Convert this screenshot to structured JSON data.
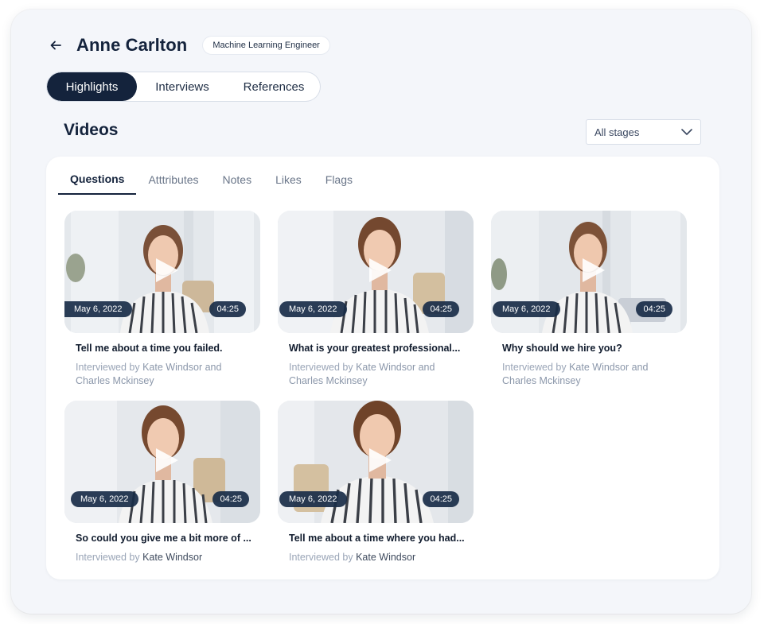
{
  "candidate": {
    "name": "Anne Carlton",
    "role": "Machine Learning Engineer"
  },
  "main_tabs": [
    {
      "label": "Highlights",
      "active": true
    },
    {
      "label": "Interviews",
      "active": false
    },
    {
      "label": "References",
      "active": false
    }
  ],
  "section": {
    "title": "Videos",
    "stage_filter": "All stages"
  },
  "sub_tabs": [
    {
      "label": "Questions",
      "active": true
    },
    {
      "label": "Atttributes",
      "active": false
    },
    {
      "label": "Notes",
      "active": false
    },
    {
      "label": "Likes",
      "active": false
    },
    {
      "label": "Flags",
      "active": false
    }
  ],
  "videos": [
    {
      "date": "May 6, 2022",
      "duration": "04:25",
      "question": "Tell me about a time you failed.",
      "interviewed_by": "Interviewed by",
      "interviewers_line1": "Kate Windsor and",
      "interviewers_line2": "Charles Mckinsey"
    },
    {
      "date": "May 6, 2022",
      "duration": "04:25",
      "question": "What is your greatest professional...",
      "interviewed_by": "Interviewed by",
      "interviewers_line1": "Kate Windsor and",
      "interviewers_line2": "Charles Mckinsey"
    },
    {
      "date": "May 6, 2022",
      "duration": "04:25",
      "question": "Why should we hire you?",
      "interviewed_by": "Interviewed by",
      "interviewers_line1": "Kate Windsor and",
      "interviewers_line2": "Charles Mckinsey"
    },
    {
      "date": "May 6, 2022",
      "duration": "04:25",
      "question": "So could you give me a bit more of ...",
      "interviewed_by": "Interviewed by",
      "interviewers_line1": "Kate Windsor",
      "interviewers_line2": ""
    },
    {
      "date": "May 6, 2022",
      "duration": "04:25",
      "question": "Tell me about a time where you had...",
      "interviewed_by": "Interviewed by",
      "interviewers_line1": "Kate Windsor",
      "interviewers_line2": ""
    }
  ],
  "icons": {
    "back": "arrow-left-icon",
    "dropdown": "chevron-down-icon",
    "play": "play-icon"
  },
  "colors": {
    "primary_navy": "#14233c",
    "badge_navy": "#192d48",
    "muted_text": "#9aa5b7",
    "page_bg": "#f4f6fa"
  }
}
